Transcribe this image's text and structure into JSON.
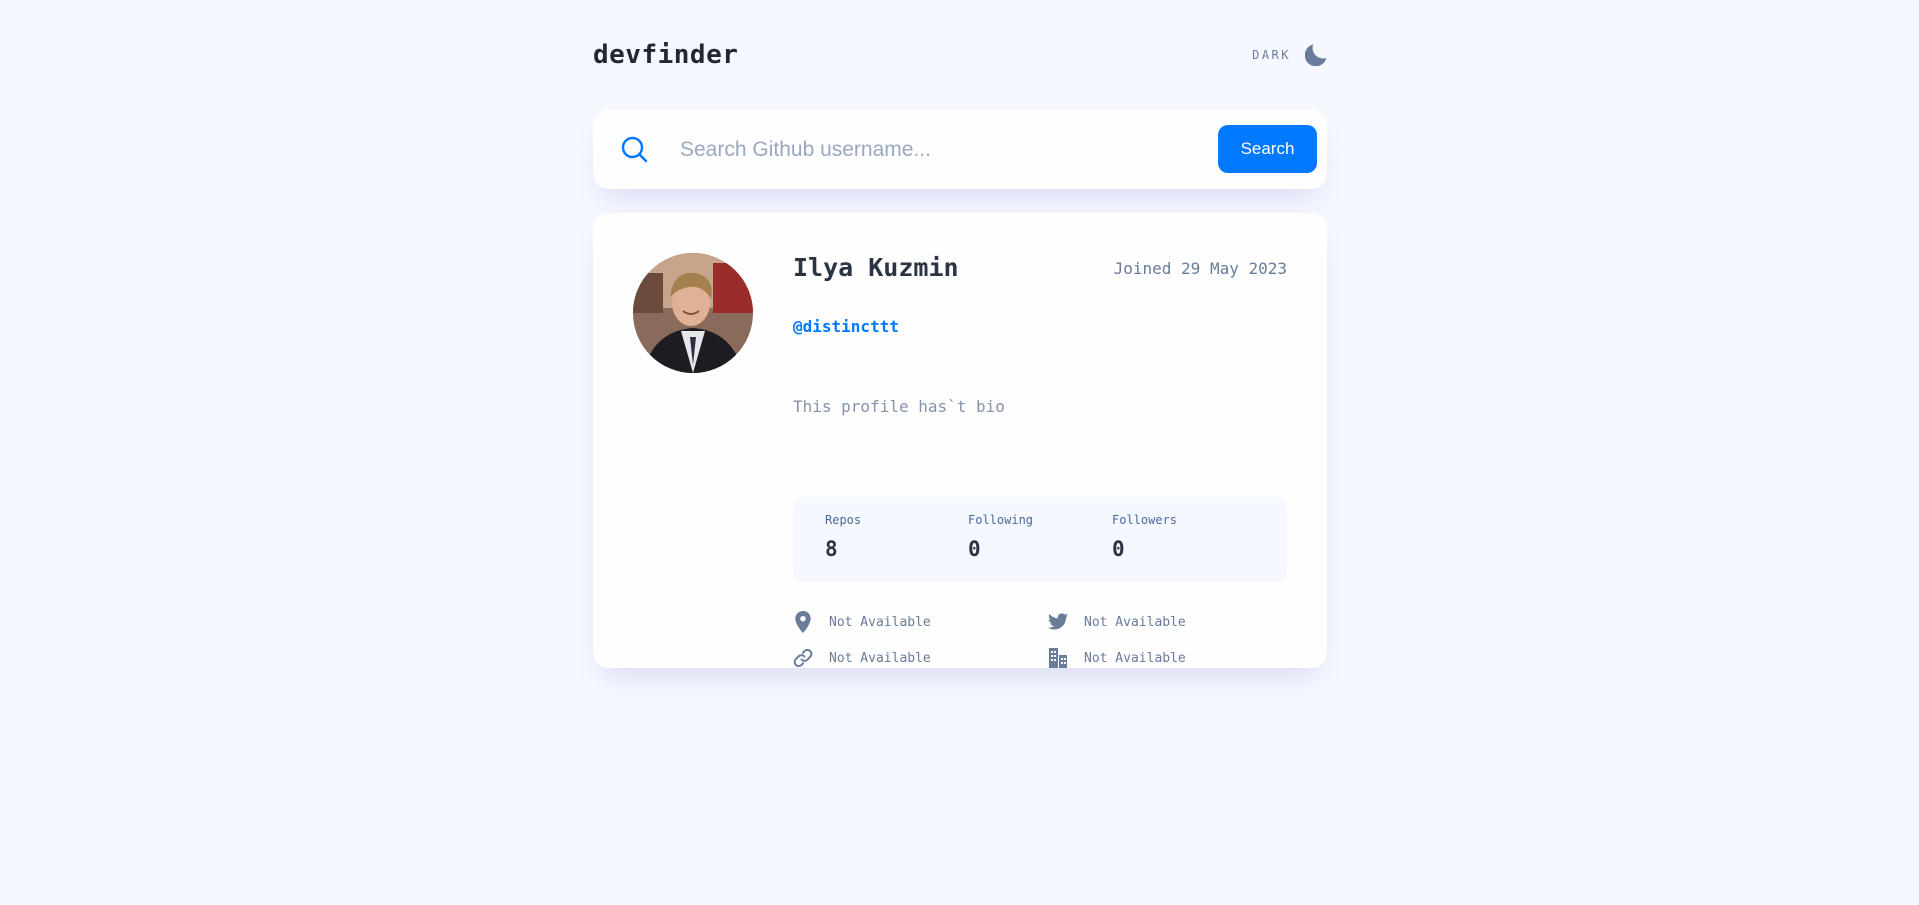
{
  "header": {
    "logo": "devfinder",
    "theme_label": "DARK",
    "theme_icon": "moon-icon"
  },
  "search": {
    "placeholder": "Search Github username...",
    "value": "",
    "button_label": "Search",
    "icon": "search-icon"
  },
  "profile": {
    "name": "Ilya Kuzmin",
    "joined": "Joined 29 May 2023",
    "login": "@distincttt",
    "bio": "This profile has`t bio",
    "stats": [
      {
        "label": "Repos",
        "value": "8"
      },
      {
        "label": "Following",
        "value": "0"
      },
      {
        "label": "Followers",
        "value": "0"
      }
    ],
    "links": {
      "location": {
        "icon": "location-pin-icon",
        "text": "Not Available"
      },
      "twitter": {
        "icon": "twitter-icon",
        "text": "Not Available"
      },
      "blog": {
        "icon": "link-icon",
        "text": "Not Available"
      },
      "company": {
        "icon": "company-building-icon",
        "text": "Not Available"
      }
    }
  },
  "colors": {
    "background": "#f6f8ff",
    "card": "#fefefe",
    "accent": "#0079ff",
    "text_dark": "#2b3442",
    "text_muted": "#697c9a"
  }
}
